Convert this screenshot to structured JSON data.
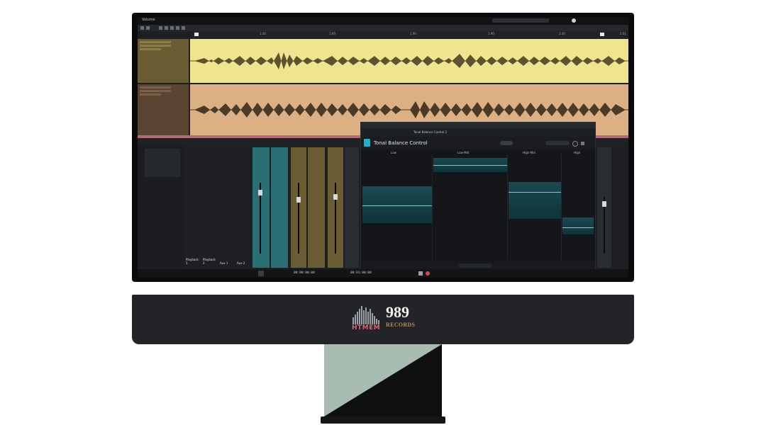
{
  "daw": {
    "menu": {
      "app_label": "Volume",
      "items": [
        "",
        "",
        "",
        ""
      ]
    },
    "ruler_numbers": [
      "1.00",
      "1.60",
      "1.90",
      "1.90",
      "2.00",
      "2.01"
    ],
    "tracks": [
      {
        "name": "",
        "color": "#f0e68c",
        "header_color": "#6b5d33"
      },
      {
        "name": "",
        "color": "#deb887",
        "header_color": "#5a4532"
      }
    ],
    "mixer": {
      "strips": [
        {
          "name": "Playback 1",
          "color": "#1d1f22"
        },
        {
          "name": "Playback 2",
          "color": "#1d1f22"
        },
        {
          "name": "Aux 1",
          "color": "#1d1f22"
        },
        {
          "name": "Aux 2",
          "color": "#1d1f22"
        },
        {
          "name": "",
          "color": "#2a6f74"
        },
        {
          "name": "",
          "color": "#2a6f74"
        },
        {
          "name": "",
          "color": "#6b5d33"
        },
        {
          "name": "",
          "color": "#6b5d33"
        },
        {
          "name": "",
          "color": "#6b5d33"
        }
      ]
    },
    "plugin": {
      "title": "Tonal Balance Control",
      "bands": [
        "Low",
        "Low-Mid",
        "High-Mid",
        "High"
      ],
      "tab_label": "Tonal Balance Control 2"
    },
    "transport": {
      "time_a": "00:00:00:00",
      "time_b": "00:01:00:00"
    }
  },
  "logo": {
    "htmem": "HTMEM",
    "numbers": "989",
    "records": "RECORDS"
  },
  "colors": {
    "teal_accent": "#1bb3c4",
    "htmem_pink": "#d96477",
    "records_gold": "#b58e52",
    "stand_light": "#a9bcb1"
  }
}
